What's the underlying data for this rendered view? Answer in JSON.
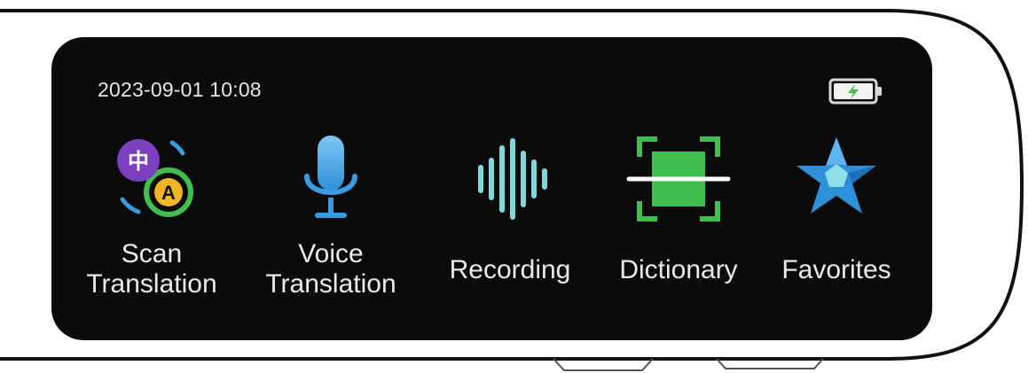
{
  "status": {
    "datetime": "2023-09-01 10:08",
    "battery_icon": "battery-charging-icon"
  },
  "apps": [
    {
      "label": "Scan\nTranslation",
      "icon": "scan-translation-icon",
      "badge_text": "中",
      "badge_text_2": "A"
    },
    {
      "label": "Voice\nTranslation",
      "icon": "microphone-icon"
    },
    {
      "label": "Recording",
      "icon": "sound-wave-icon"
    },
    {
      "label": "Dictionary",
      "icon": "dictionary-scan-icon"
    },
    {
      "label": "Favorites",
      "icon": "star-icon"
    }
  ],
  "colors": {
    "screen_bg": "#0b0b0b",
    "text": "#eaeaea",
    "purple": "#7b3fc0",
    "green": "#3fbf4f",
    "blue": "#3a9be0",
    "teal": "#7fd8d8"
  }
}
